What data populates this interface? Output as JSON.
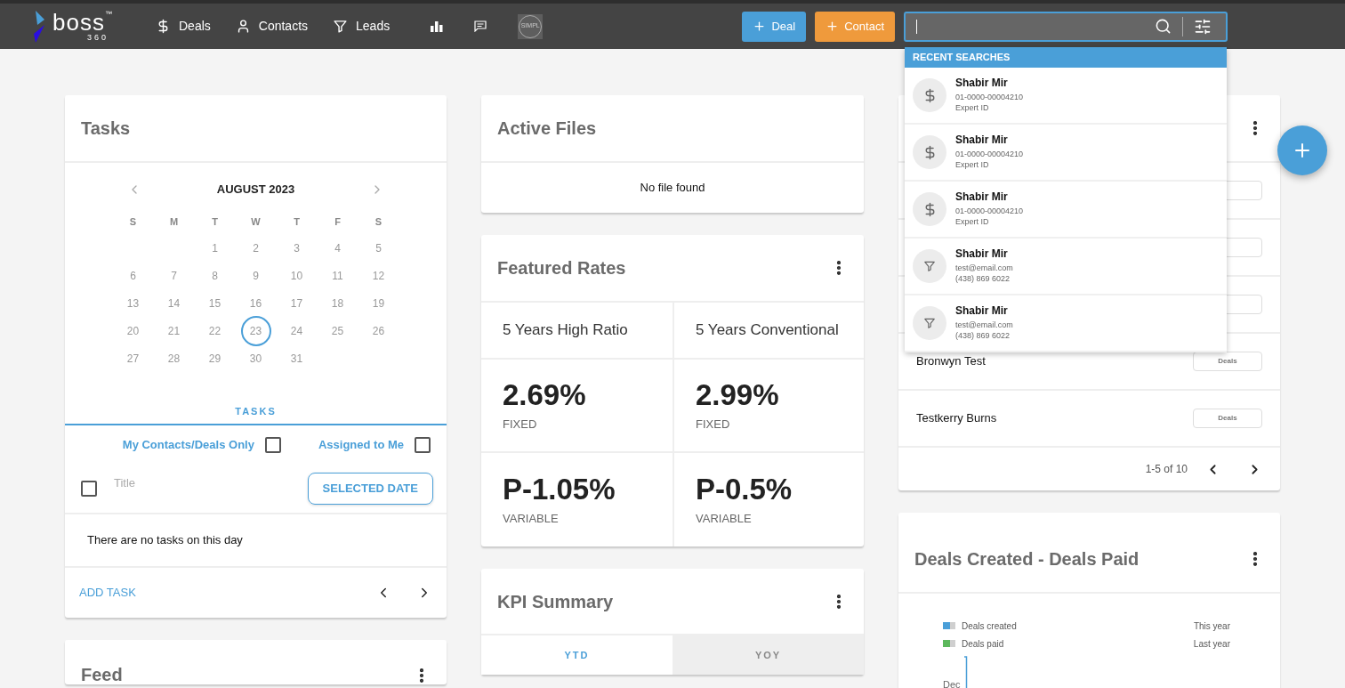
{
  "topbar": {
    "logo": {
      "name": "boss",
      "mark": "™",
      "sub": "360"
    },
    "nav": [
      {
        "kind": "deals",
        "label": "Deals"
      },
      {
        "kind": "contacts",
        "label": "Contacts"
      },
      {
        "kind": "leads",
        "label": "Leads"
      }
    ],
    "avatar_label": "SIMPL",
    "buttons": [
      {
        "label": "Deal",
        "color": "#4a9fd8"
      },
      {
        "label": "Contact",
        "color": "#ef9a3c"
      }
    ]
  },
  "recent_searches": {
    "title": "RECENT SEARCHES",
    "items": [
      {
        "kind": "deal",
        "name": "Shabir Mir",
        "line_1": "01-0000-00004210",
        "line_2": "Expert ID"
      },
      {
        "kind": "deal",
        "name": "Shabir Mir",
        "line_1": "01-0000-00004210",
        "line_2": "Expert ID"
      },
      {
        "kind": "deal",
        "name": "Shabir Mir",
        "line_1": "01-0000-00004210",
        "line_2": "Expert ID"
      },
      {
        "kind": "lead",
        "name": "Shabir Mir",
        "line_1": "test@email.com",
        "line_2": "(438) 869 6022"
      },
      {
        "kind": "lead",
        "name": "Shabir Mir",
        "line_1": "test@email.com",
        "line_2": "(438) 869 6022"
      }
    ]
  },
  "tasks": {
    "title": "Tasks",
    "calendar": {
      "month": "AUGUST 2023",
      "weekdays": [
        "S",
        "M",
        "T",
        "W",
        "T",
        "F",
        "S"
      ],
      "weeks": [
        [
          {
            "d": "1",
            "selected": false
          },
          {
            "d": "2",
            "selected": false
          },
          {
            "d": "3",
            "selected": false
          },
          {
            "d": "4",
            "selected": false
          },
          {
            "d": "5",
            "selected": false
          }
        ],
        [
          {
            "d": "6",
            "selected": false
          },
          {
            "d": "7",
            "selected": false
          },
          {
            "d": "8",
            "selected": false
          },
          {
            "d": "9",
            "selected": false
          },
          {
            "d": "10",
            "selected": false
          },
          {
            "d": "11",
            "selected": false
          },
          {
            "d": "12",
            "selected": false
          }
        ],
        [
          {
            "d": "13",
            "selected": false
          },
          {
            "d": "14",
            "selected": false
          },
          {
            "d": "15",
            "selected": false
          },
          {
            "d": "16",
            "selected": false
          },
          {
            "d": "17",
            "selected": false
          },
          {
            "d": "18",
            "selected": false
          },
          {
            "d": "19",
            "selected": false
          }
        ],
        [
          {
            "d": "20",
            "selected": false
          },
          {
            "d": "21",
            "selected": false
          },
          {
            "d": "22",
            "selected": false
          },
          {
            "d": "23",
            "selected": true
          },
          {
            "d": "24",
            "selected": false
          },
          {
            "d": "25",
            "selected": false
          },
          {
            "d": "26",
            "selected": false
          }
        ],
        [
          {
            "d": "27",
            "selected": false
          },
          {
            "d": "28",
            "selected": false
          },
          {
            "d": "29",
            "selected": false
          },
          {
            "d": "30",
            "selected": false
          },
          {
            "d": "31",
            "selected": false
          }
        ]
      ]
    },
    "tabs": [
      {
        "label": "TASKS",
        "selected": true
      }
    ],
    "filters": [
      {
        "label": "My Contacts/Deals Only",
        "checked": false
      },
      {
        "label": "Assigned to Me",
        "checked": false
      }
    ],
    "list_header": {
      "select_all_checked": false,
      "column": "Title",
      "date_button": "SELECTED DATE"
    },
    "empty_message": "There are no tasks on this day",
    "add_task": "ADD TASK"
  },
  "feed": {
    "title": "Feed"
  },
  "active_files": {
    "title": "Active Files",
    "empty_message": "No file found"
  },
  "featured_rates": {
    "title": "Featured Rates",
    "columns": [
      {
        "title": "5 Years High Ratio",
        "rates": [
          {
            "value": "2.69%",
            "type": "FIXED"
          },
          {
            "value": "P-1.05%",
            "type": "VARIABLE"
          }
        ]
      },
      {
        "title": "5 Years Conventional",
        "rates": [
          {
            "value": "2.99%",
            "type": "FIXED"
          },
          {
            "value": "P-0.5%",
            "type": "VARIABLE"
          }
        ]
      }
    ]
  },
  "kpi_summary": {
    "title": "KPI Summary",
    "tabs": [
      {
        "label": "YTD",
        "selected": true
      },
      {
        "label": "YOY",
        "selected": false
      }
    ]
  },
  "contacts_card": {
    "rows": [
      {
        "name": "Bronwyn Test",
        "tag": "Deals"
      },
      {
        "name": "Testkerry Burns",
        "tag": "Deals"
      }
    ],
    "pagination": "1-5 of 10"
  },
  "deals_chart": {
    "title": "Deals Created - Deals Paid",
    "legend": [
      {
        "label": "Deals created",
        "color": "#4a9fd8"
      },
      {
        "label": "Deals paid",
        "color": "#5cb85c"
      }
    ],
    "periods": [
      "This year",
      "Last year"
    ],
    "axis_label": "Dec"
  }
}
